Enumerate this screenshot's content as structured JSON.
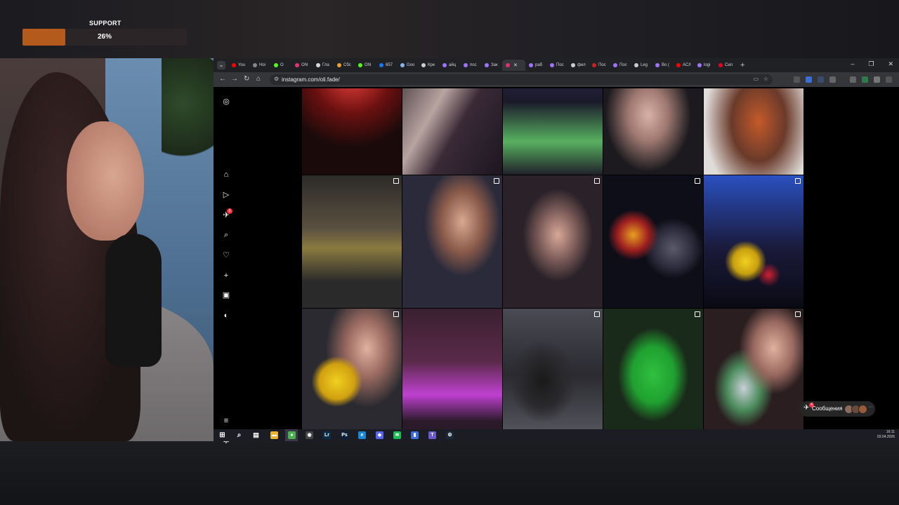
{
  "overlay": {
    "support_label": "SUPPORT",
    "support_percent": "26%",
    "support_progress": 0.26,
    "colors": {
      "progress_fill": "#b45a1c",
      "progress_track": "#2c2527"
    }
  },
  "browser": {
    "tabs": [
      {
        "label": "You",
        "favicon": "youtube-icon",
        "color": "#ff0000"
      },
      {
        "label": "Hoi",
        "favicon": "globe-icon",
        "color": "#888888"
      },
      {
        "label": "О",
        "favicon": "kick-icon",
        "color": "#53fc18"
      },
      {
        "label": "Ohl",
        "favicon": "twitch-icon",
        "color": "#e8327a"
      },
      {
        "label": "Глa",
        "favicon": "doc-icon",
        "color": "#d7d7d7"
      },
      {
        "label": "Сбс",
        "favicon": "sber-icon",
        "color": "#f0a030"
      },
      {
        "label": "Ohl",
        "favicon": "kick-icon",
        "color": "#53fc18"
      },
      {
        "label": "657",
        "favicon": "facebook-icon",
        "color": "#1877f2"
      },
      {
        "label": "Goo",
        "favicon": "gemini-icon",
        "color": "#8ab4f8"
      },
      {
        "label": "Кре",
        "favicon": "chrome-icon",
        "color": "#cccccc"
      },
      {
        "label": "айц",
        "favicon": "circle-icon",
        "color": "#a070ff"
      },
      {
        "label": "пос",
        "favicon": "circle-icon",
        "color": "#a070ff"
      },
      {
        "label": "Зак",
        "favicon": "circle-icon",
        "color": "#a070ff"
      },
      {
        "label": "",
        "favicon": "instagram-icon",
        "color": "#e1306c",
        "active": true
      },
      {
        "label": "раб",
        "favicon": "circle-icon",
        "color": "#a070ff"
      },
      {
        "label": "Пос",
        "favicon": "circle-icon",
        "color": "#a070ff"
      },
      {
        "label": "фил",
        "favicon": "chrome-icon",
        "color": "#cccccc"
      },
      {
        "label": "Пос",
        "favicon": "red-square-icon",
        "color": "#cc2222"
      },
      {
        "label": "Пос",
        "favicon": "circle-icon",
        "color": "#a070ff"
      },
      {
        "label": "Leg",
        "favicon": "chrome-icon",
        "color": "#cccccc"
      },
      {
        "label": "Во (",
        "favicon": "circle-icon",
        "color": "#a070ff"
      },
      {
        "label": "AC/I",
        "favicon": "youtube-icon",
        "color": "#ff0000"
      },
      {
        "label": "logi",
        "favicon": "circle-icon",
        "color": "#a070ff"
      },
      {
        "label": "Сил",
        "favicon": "pinterest-icon",
        "color": "#e60023"
      }
    ],
    "url": "instagram.com/oli.fade/"
  },
  "instagram": {
    "nav": [
      {
        "name": "home-icon",
        "glyph": "⌂"
      },
      {
        "name": "reels-icon",
        "glyph": "▷"
      },
      {
        "name": "messages-icon",
        "glyph": "✈",
        "badge": "5"
      },
      {
        "name": "search-icon",
        "glyph": "⌕"
      },
      {
        "name": "notifications-icon",
        "glyph": "♡"
      },
      {
        "name": "create-icon",
        "glyph": "+"
      },
      {
        "name": "dashboard-icon",
        "glyph": "▣"
      },
      {
        "name": "profile-avatar-icon",
        "glyph": "◐"
      }
    ],
    "messages_label": "Сообщения",
    "messages_badge": "4"
  },
  "taskbar": {
    "time": "16:11",
    "date": "03.04.2026",
    "apps": [
      {
        "name": "file-explorer-icon",
        "glyph": "▬",
        "color": "#e8b430"
      },
      {
        "name": "chrome-icon",
        "glyph": "●",
        "color": "#4caf50",
        "active": true
      },
      {
        "name": "obs-icon",
        "glyph": "◉",
        "color": "#444444"
      },
      {
        "name": "lightroom-icon",
        "glyph": "Lr",
        "color": "#0a2d4a"
      },
      {
        "name": "photoshop-icon",
        "glyph": "Ps",
        "color": "#0a1f3a"
      },
      {
        "name": "edge-icon",
        "glyph": "e",
        "color": "#1b86d1"
      },
      {
        "name": "discord-icon",
        "glyph": "◆",
        "color": "#5865f2"
      },
      {
        "name": "spotify-icon",
        "glyph": "≋",
        "color": "#1db954"
      },
      {
        "name": "stats-icon",
        "glyph": "▮",
        "color": "#3e6fd8"
      },
      {
        "name": "typora-icon",
        "glyph": "T",
        "color": "#6a5acd"
      },
      {
        "name": "steam-icon",
        "glyph": "⚙",
        "color": "#1b2838"
      }
    ]
  }
}
